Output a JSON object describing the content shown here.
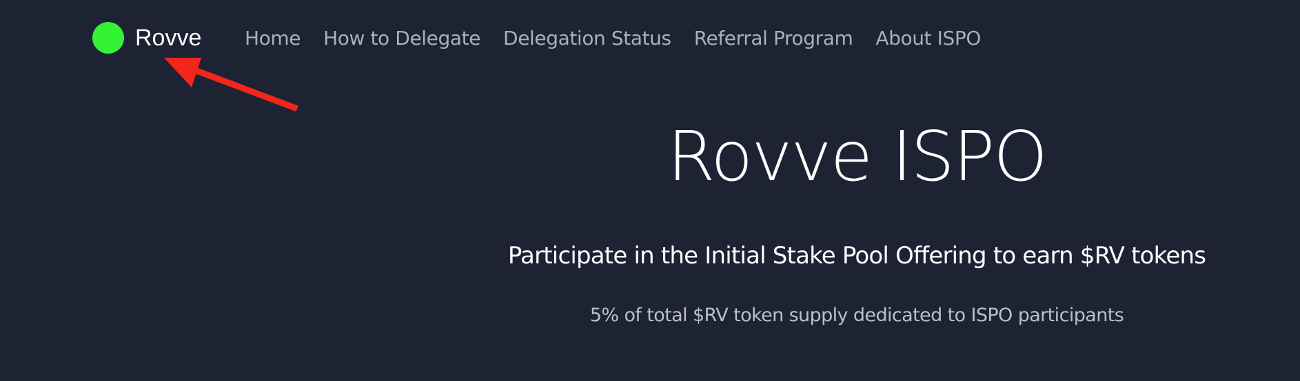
{
  "brand": {
    "name": "Rovve",
    "dot_color": "#34f234"
  },
  "nav": {
    "items": [
      {
        "label": "Home"
      },
      {
        "label": "How to Delegate"
      },
      {
        "label": "Delegation Status"
      },
      {
        "label": "Referral Program"
      },
      {
        "label": "About ISPO"
      }
    ]
  },
  "hero": {
    "title": "Rovve ISPO",
    "subtitle": "Participate in the Initial Stake Pool Offering to earn $RV tokens",
    "note": "5% of total $RV token supply dedicated to ISPO participants"
  },
  "colors": {
    "background": "#1e2333",
    "nav_text": "#a8afbd",
    "annotation_arrow": "#f2261c"
  }
}
